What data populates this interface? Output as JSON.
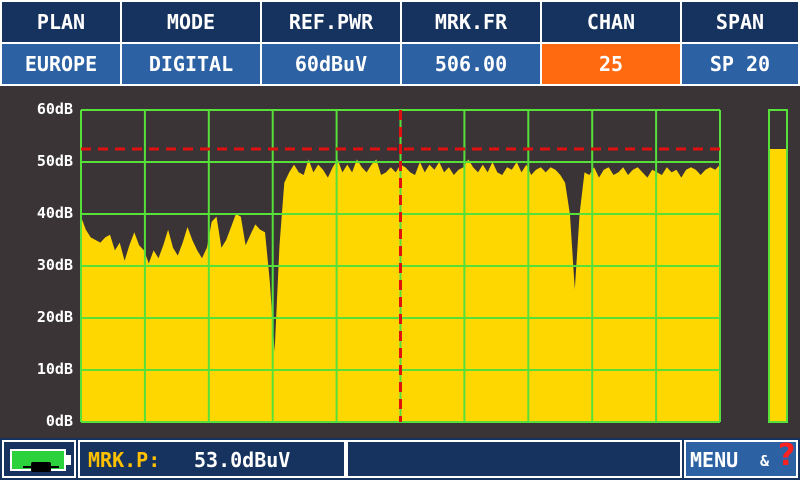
{
  "header": {
    "labels": [
      "PLAN",
      "MODE",
      "REF.PWR",
      "MRK.FR",
      "CHAN",
      "SPAN"
    ],
    "values": [
      "EUROPE",
      "DIGITAL",
      "60dBuV",
      "506.00",
      "25",
      "SP 20"
    ],
    "active_index": 4
  },
  "colors": {
    "header_bg": "#15335e",
    "value_bg": "#2c61a3",
    "active_bg": "#ff6a10",
    "trace_fill": "#ffd700",
    "grid": "#58e03a",
    "marker": "#e01010",
    "background": "#3a3436",
    "marker_label": "#ffc000"
  },
  "chart_data": {
    "type": "area",
    "ylim": [
      0,
      60
    ],
    "yticks": [
      "0dB",
      "10dB",
      "20dB",
      "30dB",
      "40dB",
      "50dB",
      "60dB"
    ],
    "grid": true,
    "reference_level_db": 52.5,
    "marker_position_fraction": 0.5,
    "level_bar_db": 52.5,
    "spectrum_db": [
      39.5,
      37,
      35.5,
      35,
      34.5,
      35.5,
      36,
      33,
      34.5,
      31,
      34,
      36.5,
      34,
      33,
      30.5,
      33,
      31.5,
      34,
      37,
      33.5,
      32,
      34.5,
      37.5,
      35,
      33,
      31.5,
      33.5,
      38.5,
      39.5,
      33.5,
      35,
      37.5,
      40,
      39.5,
      34,
      36,
      38,
      37,
      36.5,
      27,
      13.5,
      34,
      46,
      48,
      49.5,
      48,
      47.5,
      50.5,
      48,
      49.5,
      48.5,
      47,
      49,
      50.5,
      48,
      49.5,
      48,
      50.5,
      49,
      48,
      49.5,
      50.5,
      47.5,
      48,
      49,
      48,
      49.5,
      49,
      48,
      47.5,
      50,
      48,
      49.5,
      48.5,
      50,
      48,
      49,
      47.5,
      48.5,
      49,
      50.5,
      49,
      48,
      49.5,
      48,
      50,
      48,
      47.5,
      49,
      48.5,
      50,
      48,
      49.5,
      47.5,
      48.5,
      49,
      48,
      49,
      48.5,
      47.5,
      46,
      40,
      25.5,
      40,
      48,
      47.5,
      49,
      47,
      48.5,
      49,
      47.5,
      48,
      49,
      47.5,
      48.5,
      49,
      48,
      47,
      48.5,
      48,
      47.5,
      49,
      48,
      48.5,
      47,
      48.5,
      49,
      48.5,
      47.5,
      48.5,
      49,
      48.5,
      49.5
    ]
  },
  "footer": {
    "marker_label": "MRK.P:",
    "marker_value": "53.0dBuV",
    "menu_label": "MENU",
    "menu_amp": "&",
    "help_glyph": "?",
    "battery_icon": "battery-charging-icon",
    "help_icon": "help-icon"
  }
}
